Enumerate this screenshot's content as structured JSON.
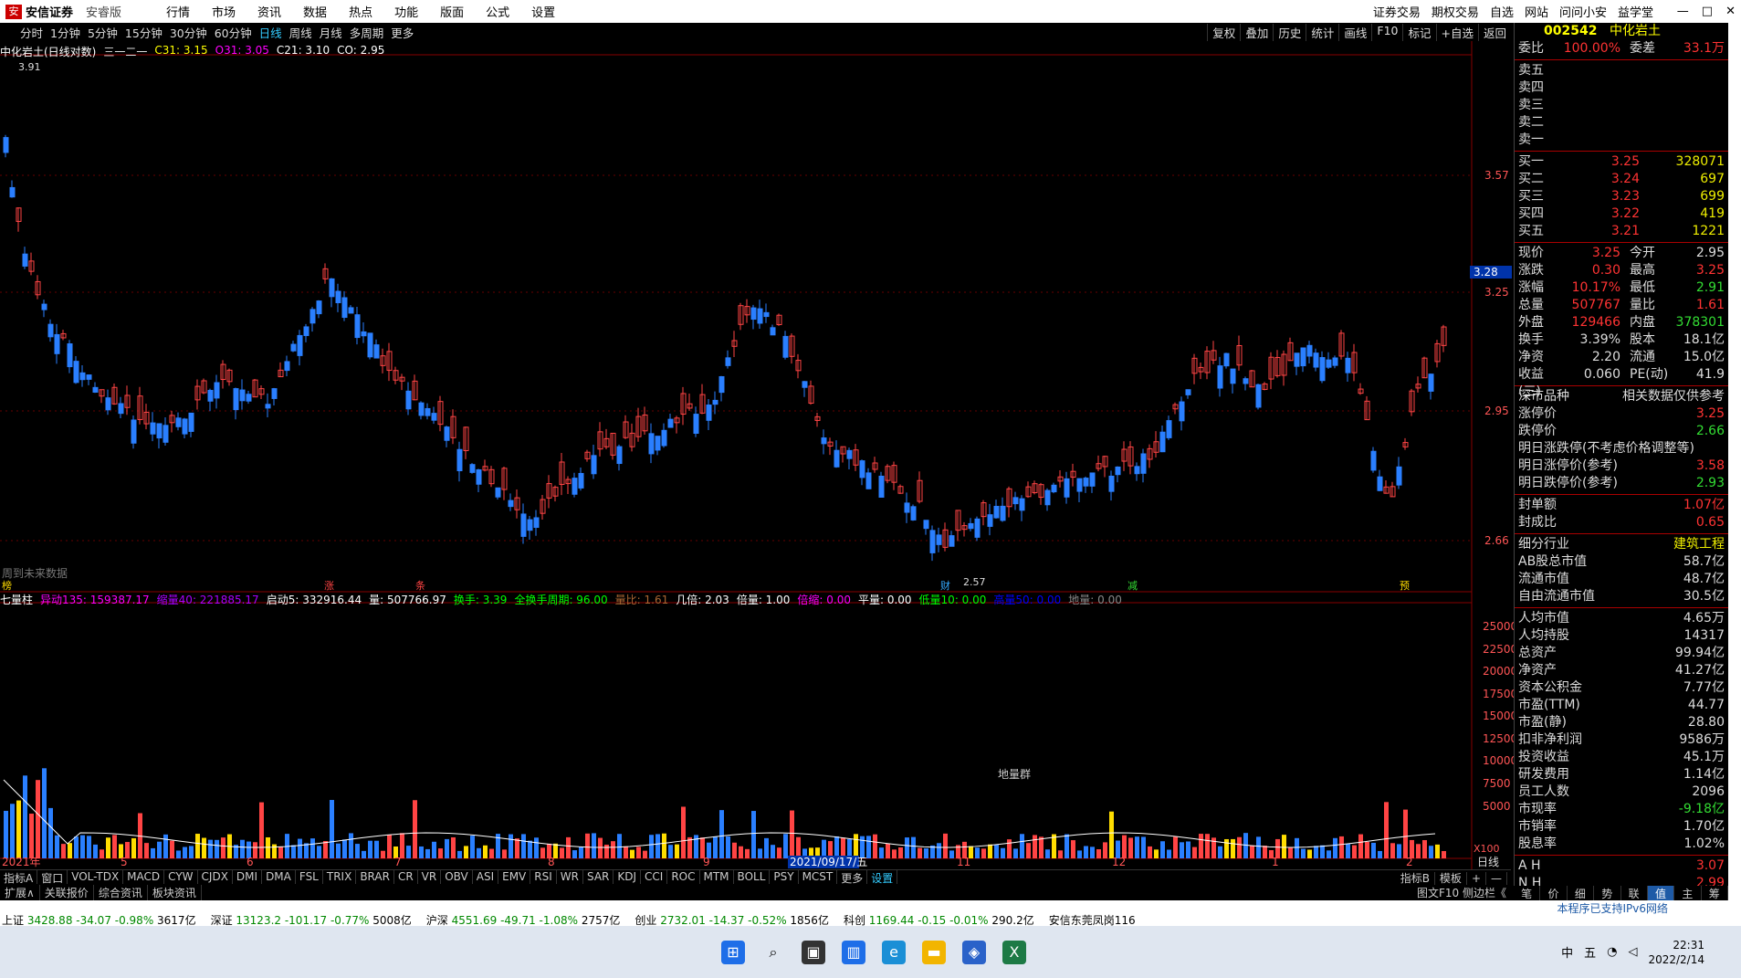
{
  "app": {
    "brand": "安信证券",
    "edition": "安睿版"
  },
  "menu": [
    "行情",
    "市场",
    "资讯",
    "数据",
    "热点",
    "功能",
    "版面",
    "公式",
    "设置"
  ],
  "menu_right": [
    "证券交易",
    "期权交易",
    "自选",
    "网站",
    "问问小安",
    "益学堂"
  ],
  "window_buttons": [
    "—",
    "□",
    "✕"
  ],
  "periods": [
    "分时",
    "1分钟",
    "5分钟",
    "15分钟",
    "30分钟",
    "60分钟",
    "日线",
    "周线",
    "月线",
    "多周期",
    "更多"
  ],
  "active_period": "日线",
  "tools": [
    "复权",
    "叠加",
    "历史",
    "统计",
    "画线",
    "F10",
    "标记",
    "+自选",
    "返回"
  ],
  "chart_header": {
    "name": "中化岩土(日线对数)",
    "ma_label": "三一二一",
    "c31": "C31: 3.15",
    "o31": "O31: 3.05",
    "c21": "C21: 3.10",
    "co": "CO: 2.95"
  },
  "price_axis": [
    "3.57",
    "3.25",
    "2.95",
    "2.66"
  ],
  "price_marker": "3.28",
  "top_price_label": "3.91",
  "low_price_label": "2.57",
  "future_text": "周到未来数据",
  "event_labels": [
    "榜",
    "涨",
    "条",
    "财",
    "减",
    "预"
  ],
  "vol_header": {
    "name": "七量柱",
    "yd": "异动135: 159387.17",
    "sl": "缩量40: 221885.17",
    "qd": "启动5: 332916.44",
    "l": "量: 507766.97",
    "hs": "换手: 3.39",
    "qhs": "全换手周期: 96.00",
    "lb": "量比: 1.61",
    "jb": "几倍: 2.03",
    "bl": "倍量: 1.00",
    "bs": "倍缩: 0.00",
    "pl": "平量: 0.00",
    "dl": "低量10: 0.00",
    "gl": "高量50: 0.00",
    "dd": "地量: 0.00"
  },
  "vol_axis": [
    "25000",
    "22500",
    "20000",
    "17500",
    "15000",
    "12500",
    "10000",
    "7500",
    "5000"
  ],
  "vol_unit": "X100",
  "vol_annotation": "地量群",
  "date_axis": [
    "2021年",
    "5",
    "6",
    "7",
    "8",
    "9",
    "2021/09/17/五",
    "11",
    "12",
    "1",
    "2"
  ],
  "date_right": "日线",
  "indicators": [
    "指标A",
    "窗口",
    "VOL-TDX",
    "MACD",
    "CYW",
    "CJDX",
    "DMI",
    "DMA",
    "FSL",
    "TRIX",
    "BRAR",
    "CR",
    "VR",
    "OBV",
    "ASI",
    "EMV",
    "RSI",
    "WR",
    "SAR",
    "KDJ",
    "CCI",
    "ROC",
    "MTM",
    "BOLL",
    "PSY",
    "MCST",
    "更多",
    "设置"
  ],
  "indicators_right": [
    "指标B",
    "模板",
    "+",
    "—"
  ],
  "bottom_tabs": [
    "扩展∧",
    "关联报价",
    "综合资讯",
    "板块资讯"
  ],
  "bottom_right": "图文F10 侧边栏《",
  "quote": {
    "code": "002542",
    "name": "中化岩土",
    "wb_label": "委比",
    "wb": "100.00%",
    "wc_label": "委差",
    "wc": "33.1万",
    "sells": [
      "卖五",
      "卖四",
      "卖三",
      "卖二",
      "卖一"
    ],
    "buys": [
      {
        "l": "买一",
        "p": "3.25",
        "v": "328071"
      },
      {
        "l": "买二",
        "p": "3.24",
        "v": "697"
      },
      {
        "l": "买三",
        "p": "3.23",
        "v": "699"
      },
      {
        "l": "买四",
        "p": "3.22",
        "v": "419"
      },
      {
        "l": "买五",
        "p": "3.21",
        "v": "1221"
      }
    ],
    "stats": [
      {
        "l1": "现价",
        "v1": "3.25",
        "l2": "今开",
        "v2": "2.95",
        "c1": "v",
        "c2": "w"
      },
      {
        "l1": "涨跌",
        "v1": "0.30",
        "l2": "最高",
        "v2": "3.25",
        "c1": "v",
        "c2": "v"
      },
      {
        "l1": "涨幅",
        "v1": "10.17%",
        "l2": "最低",
        "v2": "2.91",
        "c1": "v",
        "c2": "g"
      },
      {
        "l1": "总量",
        "v1": "507767",
        "l2": "量比",
        "v2": "1.61",
        "c1": "v",
        "c2": "v"
      },
      {
        "l1": "外盘",
        "v1": "129466",
        "l2": "内盘",
        "v2": "378301",
        "c1": "v",
        "c2": "g"
      },
      {
        "l1": "换手",
        "v1": "3.39%",
        "l2": "股本",
        "v2": "18.1亿",
        "c1": "w",
        "c2": "w"
      },
      {
        "l1": "净资",
        "v1": "2.20",
        "l2": "流通",
        "v2": "15.0亿",
        "c1": "w",
        "c2": "w"
      },
      {
        "l1": "收益(三)",
        "v1": "0.060",
        "l2": "PE(动)",
        "v2": "41.9",
        "c1": "w",
        "c2": "w"
      }
    ],
    "section": {
      "left": "深市品种",
      "right": "相关数据仅供参考"
    },
    "limits": [
      {
        "l": "涨停价",
        "v": "3.25",
        "c": "v"
      },
      {
        "l": "跌停价",
        "v": "2.66",
        "c": "g"
      },
      {
        "l": "明日涨跌停(不考虑价格调整等)",
        "v": "",
        "c": "w"
      },
      {
        "l": "明日涨停价(参考)",
        "v": "3.58",
        "c": "v"
      },
      {
        "l": "明日跌停价(参考)",
        "v": "2.93",
        "c": "g"
      }
    ],
    "seal": [
      {
        "l": "封单额",
        "v": "1.07亿",
        "c": "v"
      },
      {
        "l": "封成比",
        "v": "0.65",
        "c": "v"
      }
    ],
    "fund": [
      {
        "l": "细分行业",
        "v": "建筑工程",
        "c": "y"
      },
      {
        "l": "AB股总市值",
        "v": "58.7亿",
        "c": "w"
      },
      {
        "l": "流通市值",
        "v": "48.7亿",
        "c": "w"
      },
      {
        "l": "自由流通市值",
        "v": "30.5亿",
        "c": "w"
      },
      {
        "l": "人均市值",
        "v": "4.65万",
        "c": "w"
      },
      {
        "l": "人均持股",
        "v": "14317",
        "c": "w"
      },
      {
        "l": "总资产",
        "v": "99.94亿",
        "c": "w"
      },
      {
        "l": "净资产",
        "v": "41.27亿",
        "c": "w"
      },
      {
        "l": "资本公积金",
        "v": "7.77亿",
        "c": "w"
      },
      {
        "l": "市盈(TTM)",
        "v": "44.77",
        "c": "w"
      },
      {
        "l": "市盈(静)",
        "v": "28.80",
        "c": "w"
      },
      {
        "l": "扣非净利润",
        "v": "9586万",
        "c": "w"
      },
      {
        "l": "投资收益",
        "v": "45.1万",
        "c": "w"
      },
      {
        "l": "研发费用",
        "v": "1.14亿",
        "c": "w"
      },
      {
        "l": "员工人数",
        "v": "2096",
        "c": "w"
      },
      {
        "l": "市现率",
        "v": "-9.18亿",
        "c": "g"
      },
      {
        "l": "市销率",
        "v": "1.70亿",
        "c": "w"
      },
      {
        "l": "股息率",
        "v": "1.02%",
        "c": "w"
      }
    ],
    "ah": [
      {
        "l": "A H",
        "v": "3.07"
      },
      {
        "l": "N H",
        "v": "2.99"
      }
    ]
  },
  "right_tabs": [
    "笔",
    "价",
    "细",
    "势",
    "联",
    "值",
    "主",
    "筹"
  ],
  "status": {
    "ipv6": "本程序已支持IPv6网络",
    "indexes": [
      {
        "n": "上证",
        "p": "3428.88",
        "c": "-34.07",
        "r": "-0.98%",
        "a": "3617亿"
      },
      {
        "n": "深证",
        "p": "13123.2",
        "c": "-101.17",
        "r": "-0.77%",
        "a": "5008亿"
      },
      {
        "n": "沪深",
        "p": "4551.69",
        "c": "-49.71",
        "r": "-1.08%",
        "a": "2757亿"
      },
      {
        "n": "创业",
        "p": "2732.01",
        "c": "-14.37",
        "r": "-0.52%",
        "a": "1856亿"
      },
      {
        "n": "科创",
        "p": "1169.44",
        "c": "-0.15",
        "r": "-0.01%",
        "a": "290.2亿"
      }
    ],
    "server": "安信东莞凤岗116"
  },
  "taskbar": {
    "time": "22:31",
    "date": "2022/2/14",
    "ime": "中",
    "ime2": "五"
  }
}
